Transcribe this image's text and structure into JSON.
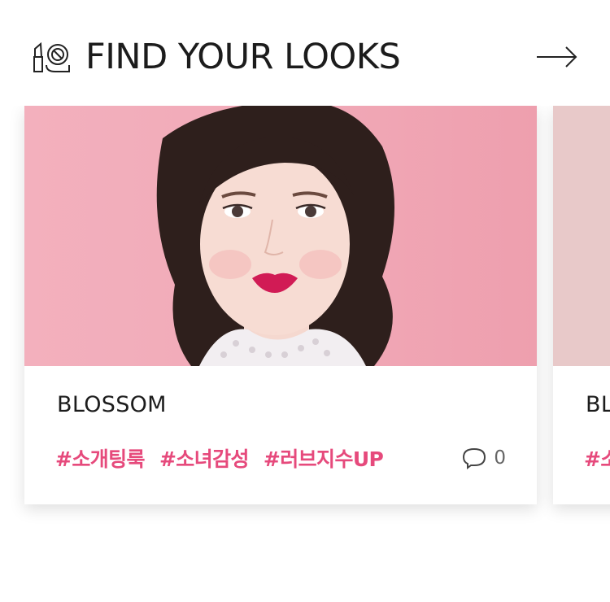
{
  "header": {
    "title": "FIND YOUR LOOKS",
    "icon": "lipstick-compact-icon",
    "next_icon": "arrow-right-icon"
  },
  "cards": [
    {
      "image": "model-portrait-pink-background",
      "title": "BLOSSOM",
      "tags": [
        "#소개팅룩",
        "#소녀감성",
        "#러브지수UP"
      ],
      "comment_icon": "comment-bubble-icon",
      "comment_count": "0"
    },
    {
      "title": "BL",
      "tags": [
        "#소"
      ]
    }
  ],
  "colors": {
    "tag": "#e64a7c",
    "image_bg": "#f1aab8",
    "next_image_bg": "#e8c9c9"
  }
}
